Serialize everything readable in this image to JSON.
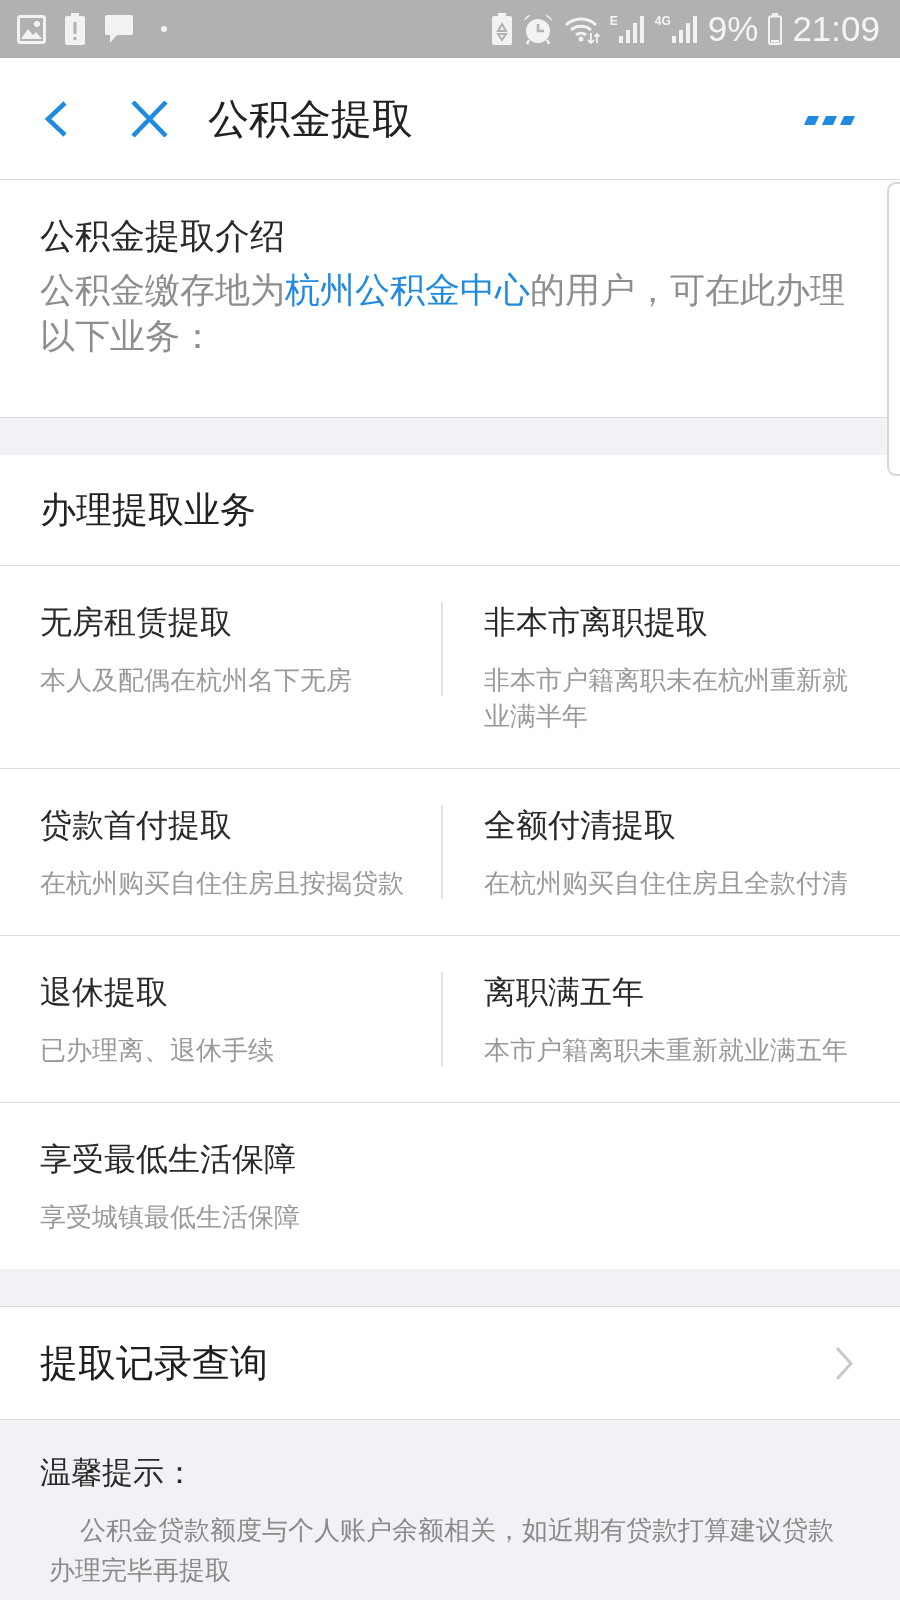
{
  "status_bar": {
    "signals": [
      {
        "label": "E"
      },
      {
        "label": "4G"
      }
    ],
    "battery": "9%",
    "time": "21:09"
  },
  "header": {
    "title": "公积金提取"
  },
  "intro": {
    "title": "公积金提取介绍",
    "text_before": "公积金缴存地为",
    "link": "杭州公积金中心",
    "text_after": "的用户，可在此办理以下业务："
  },
  "services": {
    "title": "办理提取业务",
    "items": [
      {
        "title": "无房租赁提取",
        "desc": "本人及配偶在杭州名下无房"
      },
      {
        "title": "非本市离职提取",
        "desc": "非本市户籍离职未在杭州重新就业满半年"
      },
      {
        "title": "贷款首付提取",
        "desc": "在杭州购买自住住房且按揭贷款"
      },
      {
        "title": "全额付清提取",
        "desc": "在杭州购买自住住房且全款付清"
      },
      {
        "title": "退休提取",
        "desc": "已办理离、退休手续"
      },
      {
        "title": "离职满五年",
        "desc": "本市户籍离职未重新就业满五年"
      },
      {
        "title": "享受最低生活保障",
        "desc": "享受城镇最低生活保障"
      }
    ]
  },
  "records": {
    "label": "提取记录查询"
  },
  "tips": {
    "title": "温馨提示：",
    "text": "公积金贷款额度与个人账户余额相关，如近期有贷款打算建议贷款办理完毕再提取"
  }
}
